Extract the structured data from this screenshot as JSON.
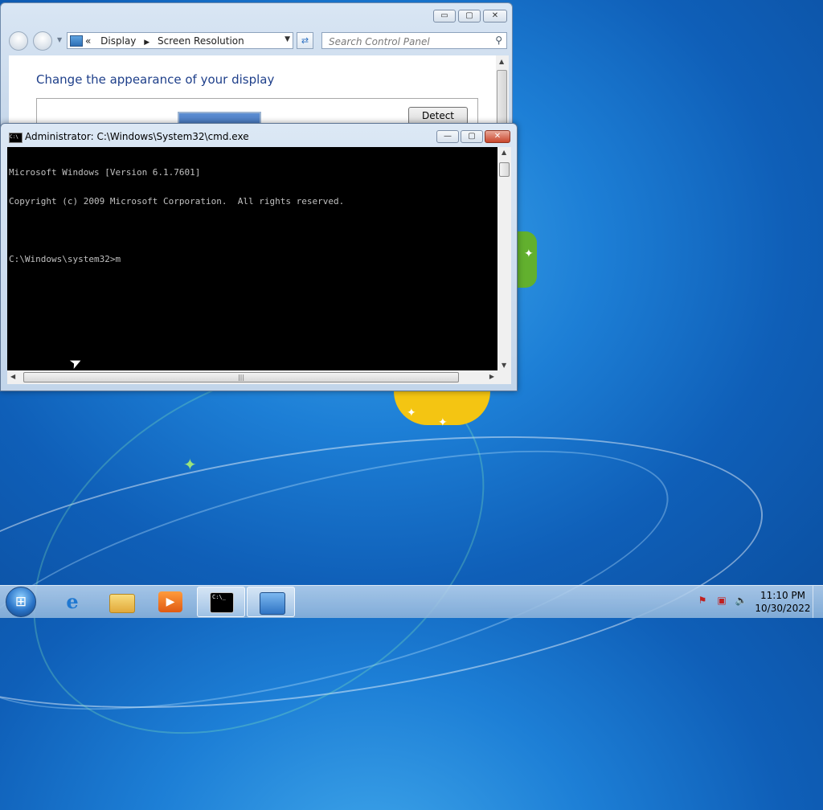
{
  "control_panel": {
    "breadcrumb": {
      "prefix": "«",
      "items": [
        "Display",
        "Screen Resolution"
      ]
    },
    "search": {
      "placeholder": "Search Control Panel"
    },
    "heading": "Change the appearance of your display",
    "detect_label": "Detect",
    "caption": {
      "minimize": "▭",
      "maximize": "▢",
      "close": "✕"
    }
  },
  "cmd": {
    "title": "Administrator: C:\\Windows\\System32\\cmd.exe",
    "icon_text": "C:\\",
    "lines": [
      "Microsoft Windows [Version 6.1.7601]",
      "Copyright (c) 2009 Microsoft Corporation.  All rights reserved.",
      "",
      "C:\\Windows\\system32>m"
    ],
    "caption": {
      "minimize": "—",
      "maximize": "▢",
      "close": "✕"
    }
  },
  "taskbar": {
    "pinned": [
      {
        "name": "internet-explorer-icon",
        "glyph": "e"
      },
      {
        "name": "windows-explorer-icon",
        "glyph": ""
      },
      {
        "name": "media-player-icon",
        "glyph": "▶"
      },
      {
        "name": "cmd-taskbar-icon",
        "glyph": "C:\\_"
      },
      {
        "name": "control-panel-taskbar-icon",
        "glyph": ""
      }
    ],
    "clock": {
      "time": "11:10 PM",
      "date": "10/30/2022"
    }
  },
  "colors": {
    "accent_title": "#1e3f8a",
    "desktop_blue": "#1d7fd6",
    "close_red": "#c9462c"
  }
}
